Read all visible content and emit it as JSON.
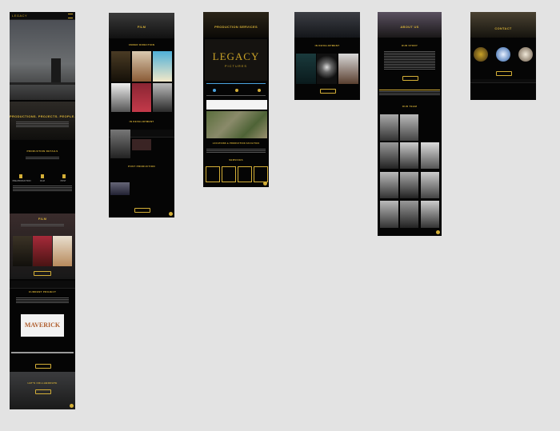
{
  "app": {
    "header_logo": "LEGACY"
  },
  "board1": {
    "section_about": "PRODUCTIONS. PROJECTS. PEOPLE.",
    "section_details": "PRODUCTION DETAILS",
    "col1": "PRE-PRODUCTION",
    "col2": "FILM",
    "col3": "POST",
    "section_film": "FILM",
    "section_current": "CURRENT PROJECT",
    "maverick": "MAVERICK",
    "section_contact": "LET'S COLLABORATE"
  },
  "board2": {
    "title": "FILM",
    "sub1": "UNDER DIRECTION",
    "sub2": "IN DEVELOPMENT",
    "sub3": "POST PRODUCTION"
  },
  "board3": {
    "title": "PRODUCTION SERVICES",
    "legacy": "LEGACY",
    "pictures": "PICTURES",
    "section_map": "LOCATIONS & PRODUCTION FACILITIES",
    "section_services": "SERVICES"
  },
  "board4": {
    "title": "IN DEVELOPMENT"
  },
  "board5": {
    "title": "ABOUT US",
    "story": "OUR STORY",
    "team": "OUR TEAM"
  },
  "board6": {
    "title": "CONTACT"
  }
}
